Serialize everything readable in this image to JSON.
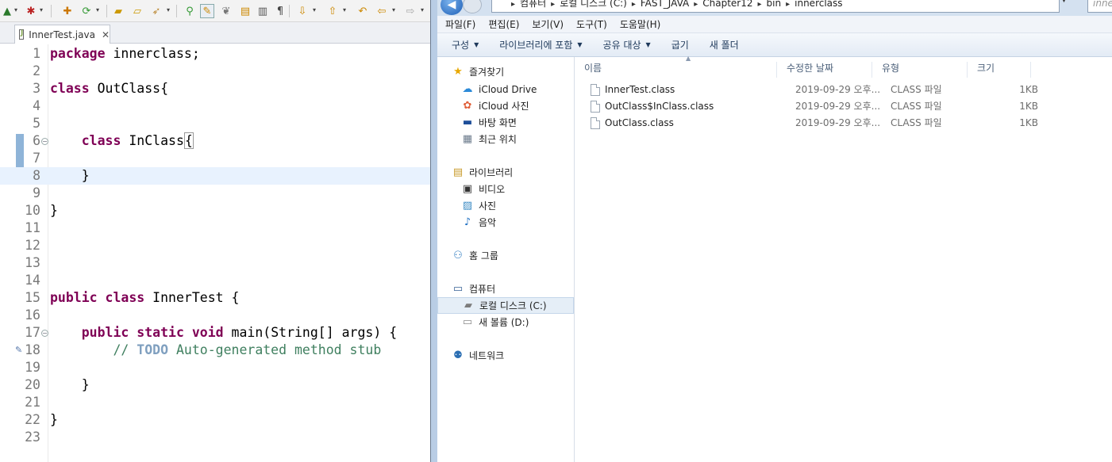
{
  "eclipse": {
    "toolbar": {
      "icons": [
        "new-server-icon",
        "debug-icon",
        "build-icon",
        "refresh-icon",
        "open-folder-icon",
        "open-type-icon",
        "run-tool-icon",
        "search-icon",
        "toggle-mark-icon",
        "word-wrap-icon",
        "open-task-icon",
        "show-whitespace-icon",
        "next-annotation-icon",
        "prev-annotation-icon",
        "last-edit-icon",
        "back-icon",
        "forward-icon"
      ]
    },
    "tab": {
      "label": "InnerTest.java",
      "close": "✕"
    },
    "code_lines": [
      {
        "num": "1",
        "text": "package innerclass;"
      },
      {
        "num": "2",
        "text": ""
      },
      {
        "num": "3",
        "text": "class OutClass{"
      },
      {
        "num": "4",
        "text": ""
      },
      {
        "num": "5",
        "text": ""
      },
      {
        "num": "6",
        "text": "    class InClass{"
      },
      {
        "num": "7",
        "text": ""
      },
      {
        "num": "8",
        "text": "    }"
      },
      {
        "num": "9",
        "text": ""
      },
      {
        "num": "10",
        "text": "}"
      },
      {
        "num": "11",
        "text": ""
      },
      {
        "num": "12",
        "text": ""
      },
      {
        "num": "13",
        "text": ""
      },
      {
        "num": "14",
        "text": ""
      },
      {
        "num": "15",
        "text": "public class InnerTest {"
      },
      {
        "num": "16",
        "text": ""
      },
      {
        "num": "17",
        "text": "    public static void main(String[] args) {"
      },
      {
        "num": "18",
        "text": "        // TODO Auto-generated method stub"
      },
      {
        "num": "19",
        "text": ""
      },
      {
        "num": "20",
        "text": "    }"
      },
      {
        "num": "21",
        "text": ""
      },
      {
        "num": "22",
        "text": "}"
      },
      {
        "num": "23",
        "text": ""
      }
    ]
  },
  "explorer": {
    "address": {
      "crumbs": [
        "컴퓨터",
        "로컬 디스크 (C:)",
        "FAST_JAVA",
        "Chapter12",
        "bin",
        "innerclass"
      ],
      "search_placeholder": "inner"
    },
    "menu": [
      "파일(F)",
      "편집(E)",
      "보기(V)",
      "도구(T)",
      "도움말(H)"
    ],
    "commands": [
      {
        "label": "구성",
        "dropdown": true
      },
      {
        "label": "라이브러리에 포함",
        "dropdown": true
      },
      {
        "label": "공유 대상",
        "dropdown": true
      },
      {
        "label": "굽기",
        "dropdown": false
      },
      {
        "label": "새 폴더",
        "dropdown": false
      }
    ],
    "nav": {
      "favorites": {
        "label": "즐겨찾기",
        "icon": "star-icon",
        "items": [
          {
            "label": "iCloud Drive",
            "icon": "icloud-drive-icon"
          },
          {
            "label": "iCloud 사진",
            "icon": "icloud-photos-icon"
          },
          {
            "label": "바탕 화면",
            "icon": "desktop-icon"
          },
          {
            "label": "최근 위치",
            "icon": "recent-places-icon"
          }
        ]
      },
      "libraries": {
        "label": "라이브러리",
        "icon": "libraries-icon",
        "items": [
          {
            "label": "비디오",
            "icon": "video-icon"
          },
          {
            "label": "사진",
            "icon": "pictures-icon"
          },
          {
            "label": "음악",
            "icon": "music-icon"
          }
        ]
      },
      "homegroup": {
        "label": "홈 그룹",
        "icon": "homegroup-icon"
      },
      "computer": {
        "label": "컴퓨터",
        "icon": "computer-icon",
        "items": [
          {
            "label": "로컬 디스크 (C:)",
            "icon": "local-disk-icon",
            "selected": true
          },
          {
            "label": "새 볼륨 (D:)",
            "icon": "volume-icon"
          }
        ]
      },
      "network": {
        "label": "네트워크",
        "icon": "network-icon"
      }
    },
    "columns": {
      "name": "이름",
      "date": "수정한 날짜",
      "type": "유형",
      "size": "크기"
    },
    "files": [
      {
        "name": "InnerTest.class",
        "date": "2019-09-29 오후...",
        "type": "CLASS 파일",
        "size": "1KB"
      },
      {
        "name": "OutClass$InClass.class",
        "date": "2019-09-29 오후...",
        "type": "CLASS 파일",
        "size": "1KB"
      },
      {
        "name": "OutClass.class",
        "date": "2019-09-29 오후...",
        "type": "CLASS 파일",
        "size": "1KB"
      }
    ]
  }
}
